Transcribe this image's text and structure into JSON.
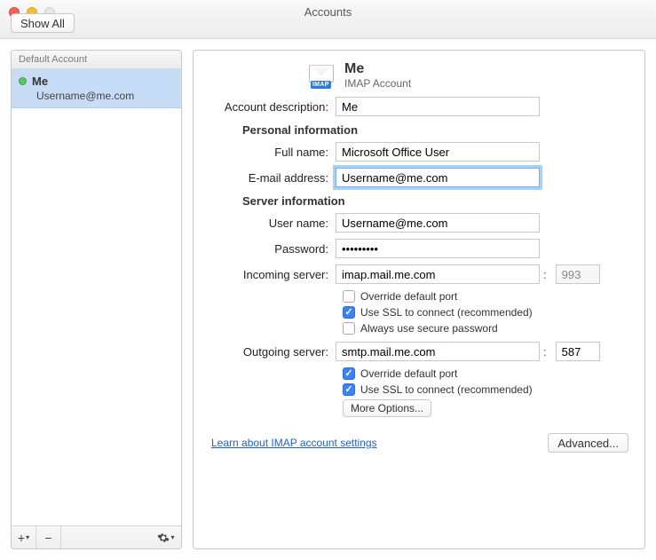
{
  "window": {
    "title": "Accounts"
  },
  "toolbar": {
    "show_all": "Show All"
  },
  "sidebar": {
    "header": "Default Account",
    "account": {
      "name": "Me",
      "subtitle": "Username@me.com"
    },
    "add_label": "+",
    "remove_label": "−"
  },
  "header": {
    "title": "Me",
    "subtitle": "IMAP Account",
    "badge": "IMAP"
  },
  "form": {
    "desc_label": "Account description:",
    "desc_value": "Me",
    "personal_section": "Personal information",
    "fullname_label": "Full name:",
    "fullname_value": "Microsoft Office User",
    "email_label": "E-mail address:",
    "email_value": "Username@me.com",
    "server_section": "Server information",
    "username_label": "User name:",
    "username_value": "Username@me.com",
    "password_label": "Password:",
    "password_value": "•••••••••",
    "incoming_label": "Incoming server:",
    "incoming_value": "imap.mail.me.com",
    "incoming_port": "993",
    "in_override": "Override default port",
    "in_ssl": "Use SSL to connect (recommended)",
    "in_secure": "Always use secure password",
    "outgoing_label": "Outgoing server:",
    "outgoing_value": "smtp.mail.me.com",
    "outgoing_port": "587",
    "out_override": "Override default port",
    "out_ssl": "Use SSL to connect (recommended)",
    "more_options": "More Options...",
    "learn_link": "Learn about IMAP account settings",
    "advanced": "Advanced..."
  }
}
